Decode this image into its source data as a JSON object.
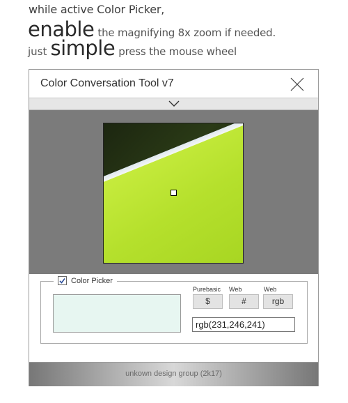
{
  "intro": {
    "line1": "while active Color Picker,",
    "line2_big": "enable",
    "line2_rest": "the magnifying 8x zoom if needed.",
    "line3_small": "just",
    "line3_big": "simple",
    "line3_rest": "press the mouse wheel"
  },
  "window": {
    "title": "Color Conversation Tool v7",
    "close_icon": "close-icon",
    "collapse_icon": "chevron-down-icon"
  },
  "picker": {
    "enabled_label": "Color Picker",
    "checked": true,
    "swatch_color": "#e7f6f1",
    "labels": {
      "purebasic": "Purebasic",
      "web1": "Web",
      "web2": "Web"
    },
    "buttons": {
      "purebasic": "$",
      "hex": "#",
      "rgb": "rgb"
    },
    "value": "rgb(231,246,241)"
  },
  "footer": {
    "text": "unkown design group (2k17)"
  }
}
